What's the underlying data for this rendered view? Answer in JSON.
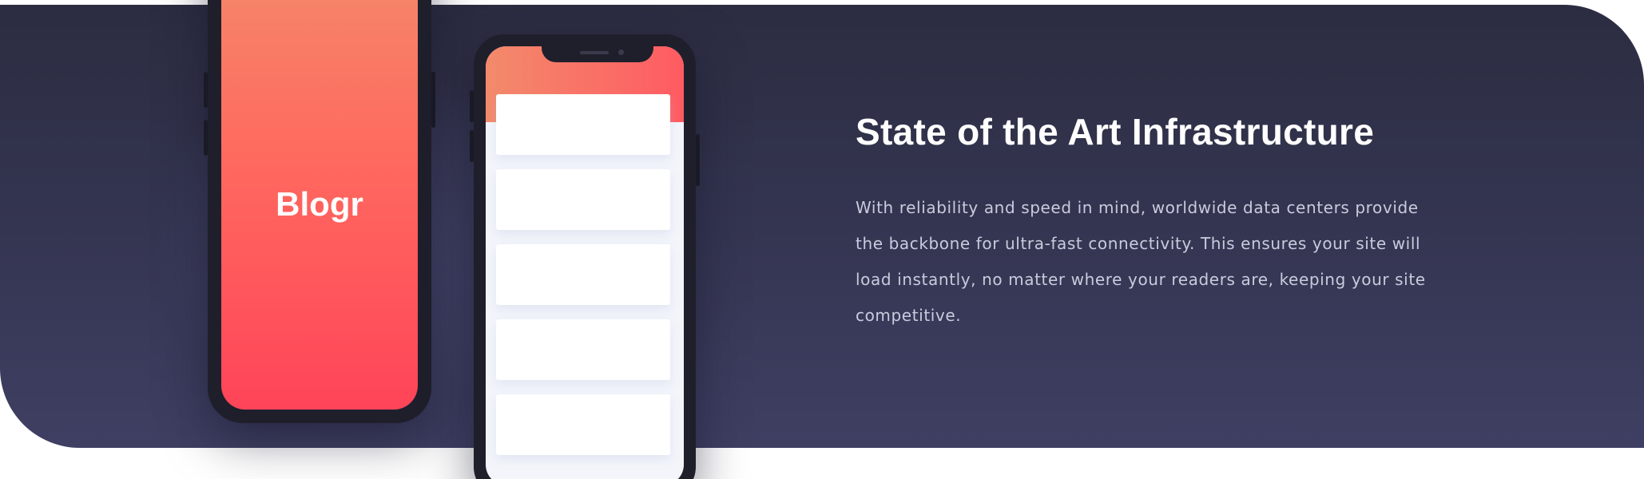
{
  "brand": {
    "name": "Blogr"
  },
  "section": {
    "title": "State of the Art Infrastructure",
    "body": "With reliability and speed in mind, worldwide data centers provide the backbone for ultra-fast connectivity. This ensures your site will load instantly, no matter where your readers are, keeping your site competitive."
  },
  "colors": {
    "panel_top": "#2c2c41",
    "panel_bottom": "#3f3f63",
    "accent_start": "#f38a6b",
    "accent_end": "#ff4459",
    "phone_frame": "#1f1f2c",
    "body_text": "#c9cbdd"
  }
}
